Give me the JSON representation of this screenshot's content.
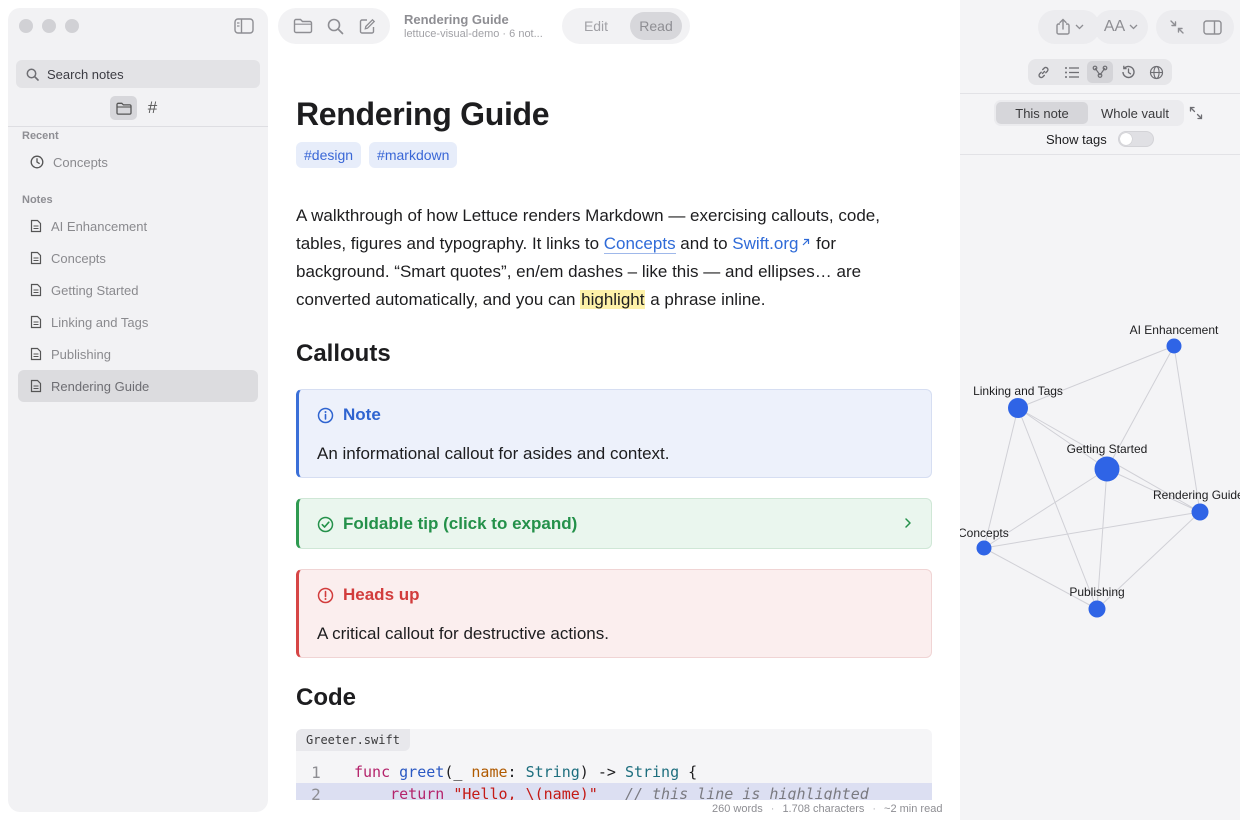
{
  "sidebar": {
    "search_placeholder": "Search notes",
    "mode_tabs": [
      {
        "icon": "folder-icon",
        "active": true
      },
      {
        "icon": "hash-icon",
        "label": "#",
        "active": false
      }
    ],
    "recent_label": "Recent",
    "recent": [
      {
        "label": "Concepts",
        "icon": "clock-icon"
      }
    ],
    "notes_label": "Notes",
    "notes": [
      {
        "label": "AI Enhancement"
      },
      {
        "label": "Concepts"
      },
      {
        "label": "Getting Started"
      },
      {
        "label": "Linking and Tags"
      },
      {
        "label": "Publishing"
      },
      {
        "label": "Rendering Guide",
        "selected": true
      }
    ]
  },
  "toolbar": {
    "doc_title": "Rendering Guide",
    "doc_subtitle": "lettuce-visual-demo · 6 not...",
    "edit_label": "Edit",
    "read_label": "Read",
    "active_mode": "Read"
  },
  "doc": {
    "title": "Rendering Guide",
    "tags": [
      "#design",
      "#markdown"
    ],
    "intro": {
      "t1": "A walkthrough of how Lettuce renders Markdown — exercising callouts, code, tables, figures and typography. It links to ",
      "link1": "Concepts",
      "t2": " and to ",
      "link2": "Swift.org",
      "t3": " for background. “Smart quotes”, en/em dashes – like this — and ellipses… are converted automatically, and you can ",
      "highlight": "highlight",
      "t4": " a phrase inline."
    },
    "callouts_heading": "Callouts",
    "callout_note": {
      "title": "Note",
      "body": "An informational callout for asides and context."
    },
    "callout_tip": {
      "title": "Foldable tip (click to expand)"
    },
    "callout_warn": {
      "title": "Heads up",
      "body": "A critical callout for destructive actions."
    },
    "code_heading": "Code",
    "code": {
      "filename": "Greeter.swift",
      "line1_no": "1",
      "line2_no": "2",
      "l1_kw": "func",
      "l1_fn": "greet",
      "l1_a": "(_ ",
      "l1_param": "name",
      "l1_b": ": ",
      "l1_type": "String",
      "l1_c": ") -> ",
      "l1_type2": "String",
      "l1_d": " {",
      "l2_kw": "    return",
      "l2_str": " \"Hello, \\(name)\"",
      "l2_cm": "   // this line is highlighted"
    }
  },
  "status": {
    "words": "260 words",
    "chars": "1.708 characters",
    "read": "~2 min read",
    "sep": "·"
  },
  "right_panel": {
    "scope_active": "This note",
    "scope_other": "Whole vault",
    "show_tags_label": "Show tags",
    "show_tags": false,
    "font_button": "AA",
    "graph": {
      "nodes": [
        {
          "label": "AI Enhancement",
          "size": "small"
        },
        {
          "label": "Linking and Tags",
          "size": "medium"
        },
        {
          "label": "Getting Started",
          "size": "large"
        },
        {
          "label": "Rendering Guide",
          "size": "small"
        },
        {
          "label": "Concepts",
          "size": "small"
        },
        {
          "label": "Publishing",
          "size": "small"
        }
      ],
      "node_color": "#2f64e6",
      "edge_color": "#d0d0d6"
    }
  },
  "colors": {
    "accent": "#2f64e6",
    "note": "#3a6fd8",
    "tip": "#2e9a50",
    "warning": "#d64545",
    "highlight": "#fdf1a8"
  }
}
